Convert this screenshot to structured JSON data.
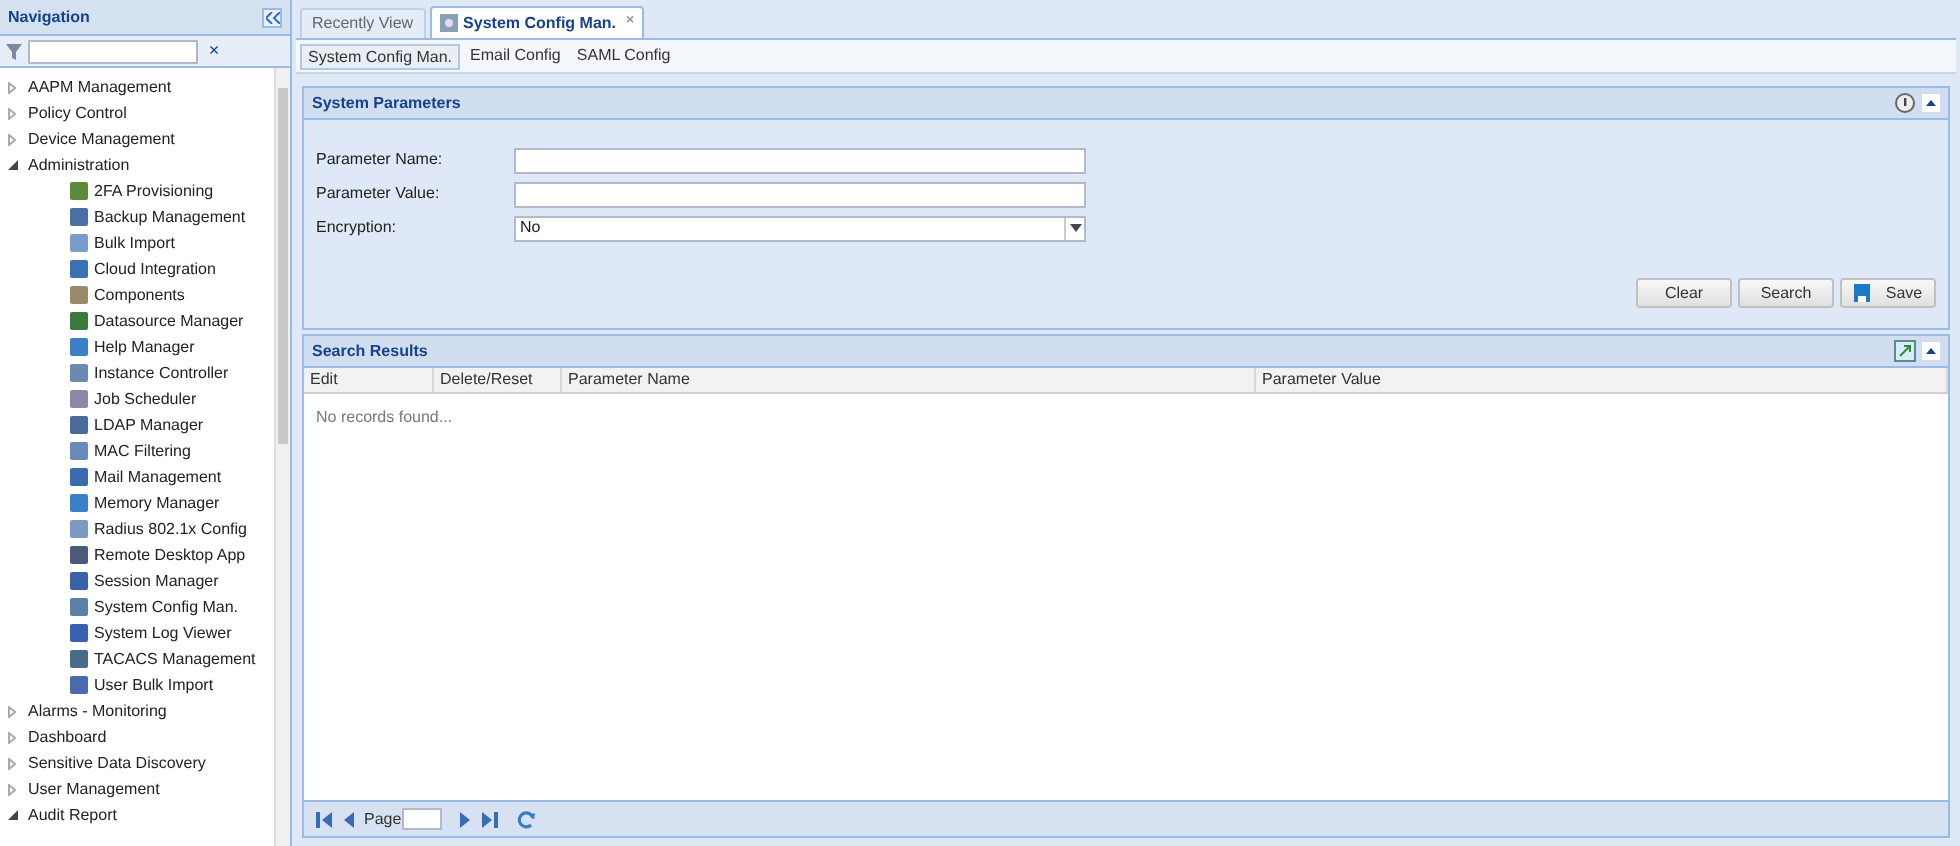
{
  "navigation": {
    "title": "Navigation",
    "clear_button": "×",
    "tree": [
      {
        "label": "AAPM Management",
        "expanded": false
      },
      {
        "label": "Policy Control",
        "expanded": false
      },
      {
        "label": "Device Management",
        "expanded": false
      },
      {
        "label": "Administration",
        "expanded": true,
        "children": [
          {
            "label": "2FA Provisioning"
          },
          {
            "label": "Backup Management"
          },
          {
            "label": "Bulk Import"
          },
          {
            "label": "Cloud Integration"
          },
          {
            "label": "Components"
          },
          {
            "label": "Datasource Manager"
          },
          {
            "label": "Help Manager"
          },
          {
            "label": "Instance Controller"
          },
          {
            "label": "Job Scheduler"
          },
          {
            "label": "LDAP Manager"
          },
          {
            "label": "MAC Filtering"
          },
          {
            "label": "Mail Management"
          },
          {
            "label": "Memory Manager"
          },
          {
            "label": "Radius 802.1x Config"
          },
          {
            "label": "Remote Desktop App"
          },
          {
            "label": "Session Manager"
          },
          {
            "label": "System Config Man."
          },
          {
            "label": "System Log Viewer"
          },
          {
            "label": "TACACS Management"
          },
          {
            "label": "User Bulk Import"
          }
        ]
      },
      {
        "label": "Alarms - Monitoring",
        "expanded": false
      },
      {
        "label": "Dashboard",
        "expanded": false
      },
      {
        "label": "Sensitive Data Discovery",
        "expanded": false
      },
      {
        "label": "User Management",
        "expanded": false
      },
      {
        "label": "Audit Report",
        "expanded": true
      }
    ]
  },
  "tabs": [
    {
      "label": "Recently View",
      "selected": false
    },
    {
      "label": "System Config Man.",
      "selected": true,
      "close": "×"
    }
  ],
  "subtabs": [
    {
      "label": "System Config Man.",
      "selected": true
    },
    {
      "label": "Email Config",
      "selected": false
    },
    {
      "label": "SAML Config",
      "selected": false
    }
  ],
  "system_parameters": {
    "title": "System Parameters",
    "fields": [
      {
        "kind": "text",
        "label": "Parameter Name:"
      },
      {
        "kind": "text",
        "label": "Parameter Value:"
      },
      {
        "kind": "select",
        "label": "Encryption:",
        "value": "No"
      }
    ],
    "buttons": [
      {
        "label": "Clear",
        "kind": "plain"
      },
      {
        "label": "Search",
        "kind": "plain"
      },
      {
        "label": "Save",
        "kind": "save"
      }
    ]
  },
  "search_results": {
    "title": "Search Results",
    "columns": [
      "Edit",
      "Delete/Reset",
      "Parameter Name",
      "Parameter Value"
    ],
    "empty_text": "No records found...",
    "pager": {
      "page_label": "Page"
    }
  }
}
